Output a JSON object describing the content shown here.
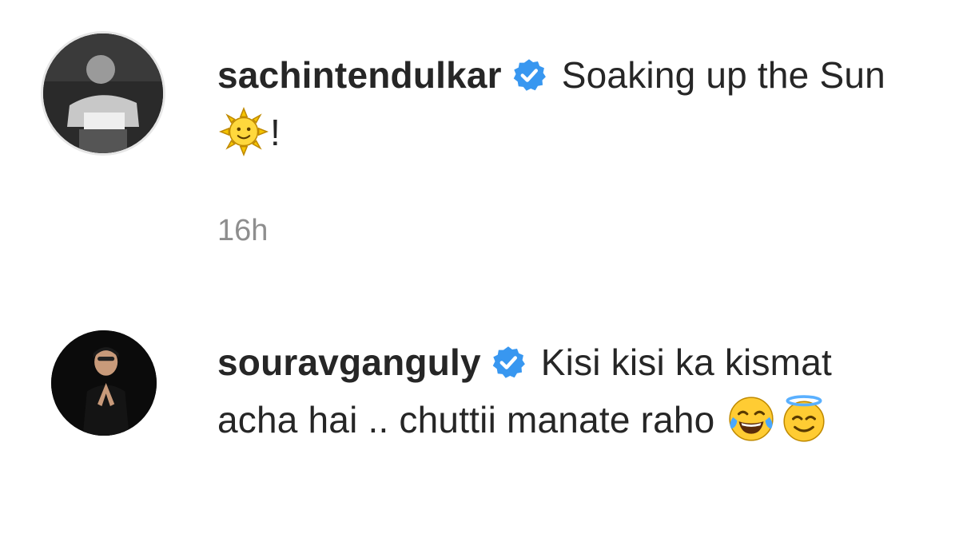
{
  "comments": [
    {
      "username": "sachintendulkar",
      "verified": true,
      "text_before_emoji": " Soaking up the Sun ",
      "emoji": "sun-with-face",
      "text_after_emoji": "!",
      "timestamp": "16h"
    },
    {
      "username": "souravganguly",
      "verified": true,
      "text_before_emoji": " Kisi kisi ka kismat acha hai .. chuttii manate raho ",
      "emojis": [
        "face-with-tears-of-joy",
        "smiling-face-with-halo"
      ]
    }
  ],
  "colors": {
    "text": "#262626",
    "muted": "#8e8e8e",
    "verified_badge": "#3897f0"
  }
}
